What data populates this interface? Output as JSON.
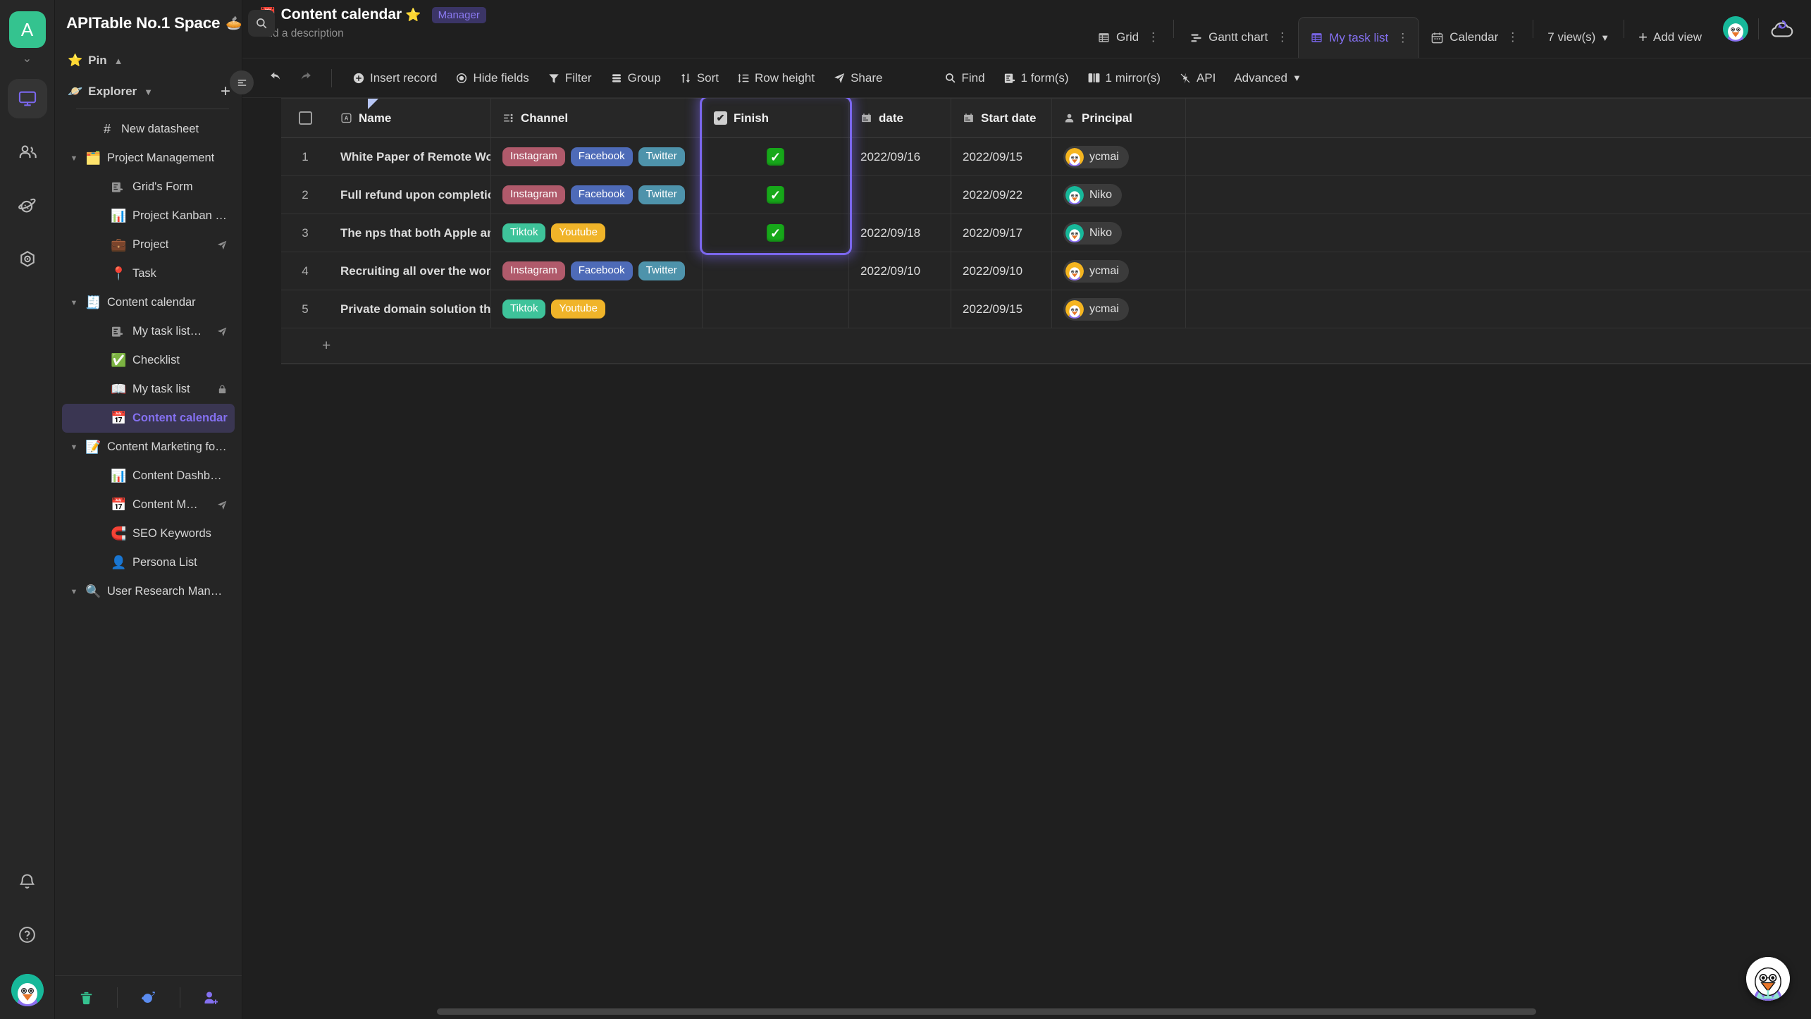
{
  "rail": {
    "workspace_initial": "A",
    "items": [
      {
        "name": "workbench",
        "icon": "monitor-icon",
        "active": true
      },
      {
        "name": "members",
        "icon": "people-icon",
        "active": false
      },
      {
        "name": "templates",
        "icon": "planet-icon",
        "active": false
      },
      {
        "name": "settings",
        "icon": "hexagon-target-icon",
        "active": false
      }
    ],
    "bottom": [
      {
        "name": "notifications",
        "icon": "bell-icon"
      },
      {
        "name": "help",
        "icon": "question-circle-icon"
      }
    ]
  },
  "sidebar": {
    "space_name": "APITable No.1 Space",
    "space_emoji": "🥧",
    "search_placeholder": "Search",
    "pin_label": "Pin",
    "explorer_label": "Explorer",
    "add_label": "+",
    "tree": [
      {
        "label": "New datasheet",
        "icon": "#",
        "indent": 1,
        "expandable": false,
        "selected": false,
        "suffix": ""
      },
      {
        "label": "Project Management",
        "icon": "🗂️",
        "indent": 0,
        "expandable": true,
        "selected": false,
        "suffix": ""
      },
      {
        "label": "Grid's Form",
        "icon": "form",
        "indent": 2,
        "expandable": false,
        "selected": false,
        "suffix": ""
      },
      {
        "label": "Project Kanban board",
        "icon": "📊",
        "indent": 2,
        "expandable": false,
        "selected": false,
        "suffix": ""
      },
      {
        "label": "Project",
        "icon": "💼",
        "indent": 2,
        "expandable": false,
        "selected": false,
        "suffix": "share"
      },
      {
        "label": "Task",
        "icon": "📍",
        "indent": 2,
        "expandable": false,
        "selected": false,
        "suffix": ""
      },
      {
        "label": "Content calendar",
        "icon": "🧾",
        "indent": 0,
        "expandable": true,
        "selected": false,
        "suffix": ""
      },
      {
        "label": "My task list's Form",
        "icon": "form",
        "indent": 2,
        "expandable": false,
        "selected": false,
        "suffix": "share"
      },
      {
        "label": "Checklist",
        "icon": "✅",
        "indent": 2,
        "expandable": false,
        "selected": false,
        "suffix": ""
      },
      {
        "label": "My task list",
        "icon": "📖",
        "indent": 2,
        "expandable": false,
        "selected": false,
        "suffix": "lock"
      },
      {
        "label": "Content calendar",
        "icon": "📅",
        "indent": 2,
        "expandable": false,
        "selected": true,
        "suffix": ""
      },
      {
        "label": "Content Marketing for SEO",
        "icon": "📝",
        "indent": 0,
        "expandable": true,
        "selected": false,
        "suffix": ""
      },
      {
        "label": "Content Dashboard",
        "icon": "📊",
        "indent": 2,
        "expandable": false,
        "selected": false,
        "suffix": ""
      },
      {
        "label": "Content Management",
        "icon": "📅",
        "indent": 2,
        "expandable": false,
        "selected": false,
        "suffix": "share"
      },
      {
        "label": "SEO Keywords",
        "icon": "🧲",
        "indent": 2,
        "expandable": false,
        "selected": false,
        "suffix": ""
      },
      {
        "label": "Persona List",
        "icon": "👤",
        "indent": 2,
        "expandable": false,
        "selected": false,
        "suffix": ""
      },
      {
        "label": "User Research Management",
        "icon": "🔍",
        "indent": 0,
        "expandable": true,
        "selected": false,
        "suffix": ""
      }
    ],
    "footer": [
      {
        "name": "trash",
        "icon": "🗑️",
        "color": "#35c28f"
      },
      {
        "name": "template-center",
        "icon": "🪐",
        "color": "#5b8cf0"
      },
      {
        "name": "invite-member",
        "icon": "👤+",
        "color": "#8470f0"
      }
    ]
  },
  "header": {
    "datasheet_icon": "📅",
    "datasheet_name": "Content calendar",
    "starred": true,
    "role_badge": "Manager",
    "description_placeholder": "Add a description",
    "views": [
      {
        "label": "Grid",
        "icon": "grid-icon",
        "active": false
      },
      {
        "label": "Gantt chart",
        "icon": "gantt-icon",
        "active": false
      },
      {
        "label": "My task list",
        "icon": "grid-icon",
        "active": true
      },
      {
        "label": "Calendar",
        "icon": "calendar-icon",
        "active": false
      }
    ],
    "view_count_label": "7 view(s)",
    "add_view_label": "Add view"
  },
  "toolbar": {
    "undo": "undo-icon",
    "redo": "redo-icon",
    "buttons": [
      {
        "label": "Insert record",
        "icon": "plus-circle-icon"
      },
      {
        "label": "Hide fields",
        "icon": "eye-icon"
      },
      {
        "label": "Filter",
        "icon": "funnel-icon"
      },
      {
        "label": "Group",
        "icon": "layers-icon"
      },
      {
        "label": "Sort",
        "icon": "sort-icon"
      },
      {
        "label": "Row height",
        "icon": "row-height-icon"
      },
      {
        "label": "Share",
        "icon": "send-icon"
      }
    ],
    "right_buttons": [
      {
        "label": "Find",
        "icon": "search-icon"
      },
      {
        "label": "1 form(s)",
        "icon": "form-icon"
      },
      {
        "label": "1 mirror(s)",
        "icon": "mirror-icon"
      },
      {
        "label": "API",
        "icon": "api-icon"
      },
      {
        "label": "Advanced",
        "icon": "chevron-down-icon"
      }
    ]
  },
  "grid": {
    "columns": [
      {
        "key": "name",
        "label": "Name",
        "icon": "text-field-icon"
      },
      {
        "key": "channel",
        "label": "Channel",
        "icon": "multiselect-icon"
      },
      {
        "key": "finish",
        "label": "Finish",
        "icon": "checkbox-field-icon",
        "highlighted": true
      },
      {
        "key": "date",
        "label": "date",
        "icon": "date-field-icon"
      },
      {
        "key": "start",
        "label": "Start date",
        "icon": "date-field-icon"
      },
      {
        "key": "principal",
        "label": "Principal",
        "icon": "member-field-icon"
      }
    ],
    "add_row_label": "+",
    "tag_colors": {
      "Instagram": "#b05a6b",
      "Facebook": "#4e6bb8",
      "Twitter": "#4e93ab",
      "Tiktok": "#3ec39a",
      "Youtube": "#f0b429"
    },
    "rows": [
      {
        "num": "1",
        "name": "White Paper of Remote Work",
        "channel": [
          "Instagram",
          "Facebook",
          "Twitter"
        ],
        "finish": true,
        "date": "2022/09/16",
        "start": "2022/09/15",
        "principal": "ycmai",
        "principal_color": "#f5b51f"
      },
      {
        "num": "2",
        "name": "Full refund upon completion ...",
        "channel": [
          "Instagram",
          "Facebook",
          "Twitter"
        ],
        "finish": true,
        "date": "",
        "start": "2022/09/22",
        "principal": "Niko",
        "principal_color": "#17b89a"
      },
      {
        "num": "3",
        "name": "The nps that both Apple and ...",
        "channel": [
          "Tiktok",
          "Youtube"
        ],
        "finish": true,
        "date": "2022/09/18",
        "start": "2022/09/17",
        "principal": "Niko",
        "principal_color": "#17b89a"
      },
      {
        "num": "4",
        "name": "Recruiting all over the world",
        "channel": [
          "Instagram",
          "Facebook",
          "Twitter"
        ],
        "finish": false,
        "date": "2022/09/10",
        "start": "2022/09/10",
        "principal": "ycmai",
        "principal_color": "#f5b51f"
      },
      {
        "num": "5",
        "name": "Private domain solution that ...",
        "channel": [
          "Tiktok",
          "Youtube"
        ],
        "finish": false,
        "date": "",
        "start": "2022/09/15",
        "principal": "ycmai",
        "principal_color": "#f5b51f"
      }
    ]
  },
  "colors": {
    "accent": "#7b67ee",
    "selected_bg": "#3a3652",
    "green": "#34c38f",
    "highlight_border": "#7b67ee"
  }
}
